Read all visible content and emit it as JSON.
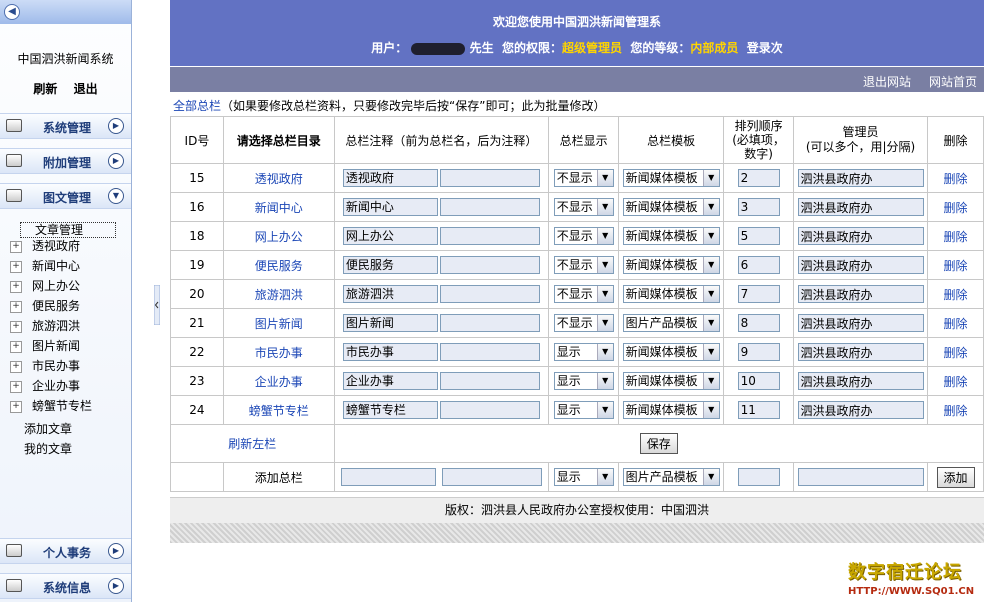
{
  "sidebar": {
    "system_name": "中国泗洪新闻系统",
    "refresh": "刷新",
    "logout": "退出",
    "sections": [
      "系统管理",
      "附加管理",
      "图文管理"
    ],
    "tree_head": "文章管理",
    "tree_items": [
      "透视政府",
      "新闻中心",
      "网上办公",
      "便民服务",
      "旅游泗洪",
      "图片新闻",
      "市民办事",
      "企业办事",
      "螃蟹节专栏"
    ],
    "tree_subs": [
      "添加文章",
      "我的文章"
    ],
    "bottom_sections": [
      "个人事务",
      "系统信息"
    ]
  },
  "header": {
    "title": "欢迎您使用中国泗洪新闻管理系",
    "user_label": "用户：",
    "user_suffix": "先生",
    "perm_label": "您的权限：",
    "perm_value": "超级管理员",
    "level_label": "您的等级：",
    "level_value": "内部成员",
    "login_text": "登录次"
  },
  "nav": {
    "exit_site": "退出网站",
    "home": "网站首页"
  },
  "notice": {
    "link": "全部总栏",
    "text": "（如果要修改总栏资料，只要修改完毕后按“保存”即可；此为批量修改）"
  },
  "columns": {
    "id": "ID号",
    "category": "请选择总栏目录",
    "note": "总栏注释（前为总栏名，后为注释）",
    "display": "总栏显示",
    "template": "总栏模板",
    "order1": "排列顺序",
    "order2": "(必填项，",
    "order3": "数字)",
    "admin1": "管理员",
    "admin2": "(可以多个，用|分隔)",
    "delete": "删除"
  },
  "rows": [
    {
      "id": "15",
      "name": "透视政府",
      "note": "透视政府",
      "display": "不显示",
      "template": "新闻媒体模板",
      "order": "2",
      "admin": "泗洪县政府办",
      "del": "删除"
    },
    {
      "id": "16",
      "name": "新闻中心",
      "note": "新闻中心",
      "display": "不显示",
      "template": "新闻媒体模板",
      "order": "3",
      "admin": "泗洪县政府办",
      "del": "删除"
    },
    {
      "id": "18",
      "name": "网上办公",
      "note": "网上办公",
      "display": "不显示",
      "template": "新闻媒体模板",
      "order": "5",
      "admin": "泗洪县政府办",
      "del": "删除"
    },
    {
      "id": "19",
      "name": "便民服务",
      "note": "便民服务",
      "display": "不显示",
      "template": "新闻媒体模板",
      "order": "6",
      "admin": "泗洪县政府办",
      "del": "删除"
    },
    {
      "id": "20",
      "name": "旅游泗洪",
      "note": "旅游泗洪",
      "display": "不显示",
      "template": "新闻媒体模板",
      "order": "7",
      "admin": "泗洪县政府办",
      "del": "删除"
    },
    {
      "id": "21",
      "name": "图片新闻",
      "note": "图片新闻",
      "display": "不显示",
      "template": "图片产品模板",
      "order": "8",
      "admin": "泗洪县政府办",
      "del": "删除"
    },
    {
      "id": "22",
      "name": "市民办事",
      "note": "市民办事",
      "display": "显示",
      "template": "新闻媒体模板",
      "order": "9",
      "admin": "泗洪县政府办",
      "del": "删除"
    },
    {
      "id": "23",
      "name": "企业办事",
      "note": "企业办事",
      "display": "显示",
      "template": "新闻媒体模板",
      "order": "10",
      "admin": "泗洪县政府办",
      "del": "删除"
    },
    {
      "id": "24",
      "name": "螃蟹节专栏",
      "note": "螃蟹节专栏",
      "display": "显示",
      "template": "新闻媒体模板",
      "order": "11",
      "admin": "泗洪县政府办",
      "del": "删除"
    }
  ],
  "actions": {
    "refresh_left": "刷新左栏",
    "save": "保存",
    "add_label": "添加总栏",
    "add_display": "显示",
    "add_template": "图片产品模板",
    "add_button": "添加"
  },
  "footer": {
    "text": "版权：泗洪县人民政府办公室授权使用：中国泗洪"
  },
  "watermark": {
    "line1": "数字宿迁论坛",
    "line2": "HTTP://WWW.SQ01.CN"
  }
}
